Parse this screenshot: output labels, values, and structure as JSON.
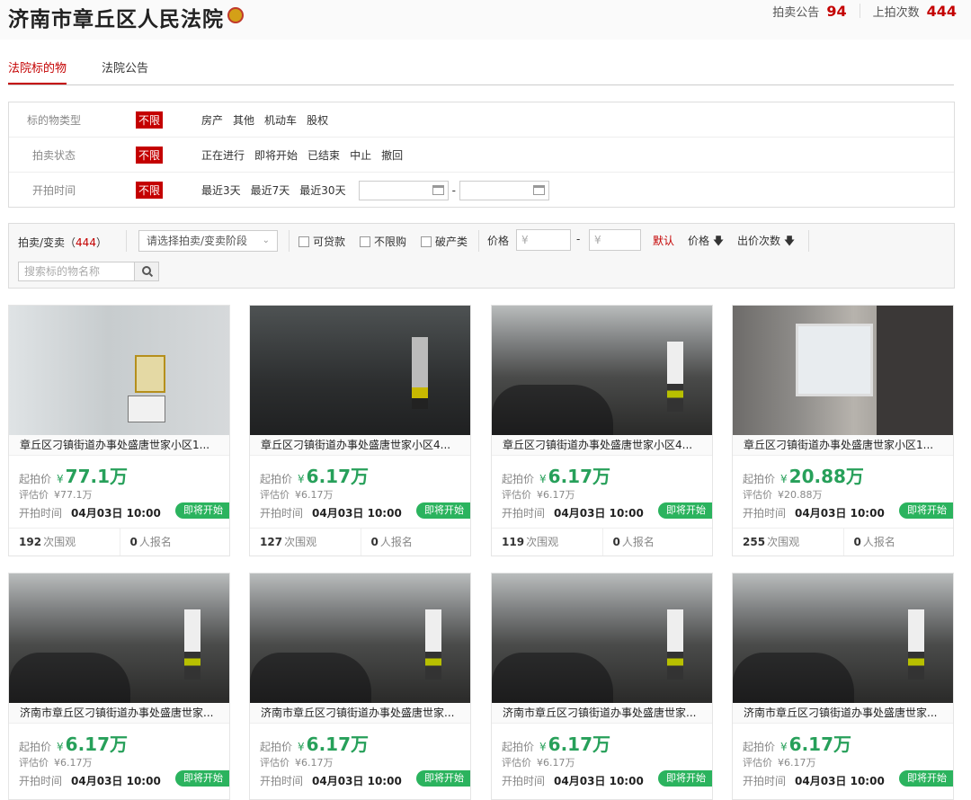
{
  "header": {
    "court_name": "济南市章丘区人民法院",
    "notice_label": "拍卖公告",
    "notice_count": "94",
    "auction_label": "上拍次数",
    "auction_count": "444"
  },
  "tabs": [
    "法院标的物",
    "法院公告"
  ],
  "filters": {
    "unlimited": "不限",
    "rows": [
      {
        "label": "标的物类型",
        "options": [
          "房产",
          "其他",
          "机动车",
          "股权"
        ]
      },
      {
        "label": "拍卖状态",
        "options": [
          "正在进行",
          "即将开始",
          "已结束",
          "中止",
          "撤回"
        ]
      },
      {
        "label": "开拍时间",
        "options": [
          "最近3天",
          "最近7天",
          "最近30天"
        ]
      }
    ],
    "date_separator": "-"
  },
  "toolbar": {
    "auction_type_label": "拍卖/变卖（",
    "auction_type_count": "444",
    "auction_type_close": "）",
    "stage_select": "请选择拍卖/变卖阶段",
    "checkboxes": [
      "可贷款",
      "不限购",
      "破产类"
    ],
    "price_label": "价格",
    "price_min_placeholder": "¥",
    "price_max_placeholder": "¥",
    "price_dash": "-",
    "sort_default": "默认",
    "sort_price": "价格",
    "sort_bids": "出价次数",
    "search_placeholder": "搜索标的物名称"
  },
  "card_labels": {
    "start_price": "起拍价",
    "eval_price": "评估价",
    "start_time": "开拍时间",
    "badge": "即将开始",
    "views_suffix": "次围观",
    "signups_suffix": "人报名",
    "currency": "¥"
  },
  "cards": [
    {
      "title": "章丘区刁镇街道办事处盛唐世家小区1...",
      "price": "77.1万",
      "eval": "¥77.1万",
      "time": "04月03日 10:00",
      "views": "192",
      "signups": "0",
      "image": "gas-meter-photo"
    },
    {
      "title": "章丘区刁镇街道办事处盛唐世家小区4...",
      "price": "6.17万",
      "eval": "¥6.17万",
      "time": "04月03日 10:00",
      "views": "127",
      "signups": "0",
      "image": "underground-garage-photo"
    },
    {
      "title": "章丘区刁镇街道办事处盛唐世家小区4...",
      "price": "6.17万",
      "eval": "¥6.17万",
      "time": "04月03日 10:00",
      "views": "119",
      "signups": "0",
      "image": "parking-car-photo"
    },
    {
      "title": "章丘区刁镇街道办事处盛唐世家小区1...",
      "price": "20.88万",
      "eval": "¥20.88万",
      "time": "04月03日 10:00",
      "views": "255",
      "signups": "0",
      "image": "interior-room-photo"
    },
    {
      "title": "济南市章丘区刁镇街道办事处盛唐世家...",
      "price": "6.17万",
      "eval": "¥6.17万",
      "time": "04月03日 10:00",
      "views": "",
      "signups": "",
      "image": "parking-car-photo"
    },
    {
      "title": "济南市章丘区刁镇街道办事处盛唐世家...",
      "price": "6.17万",
      "eval": "¥6.17万",
      "time": "04月03日 10:00",
      "views": "",
      "signups": "",
      "image": "parking-car-photo"
    },
    {
      "title": "济南市章丘区刁镇街道办事处盛唐世家...",
      "price": "6.17万",
      "eval": "¥6.17万",
      "time": "04月03日 10:00",
      "views": "",
      "signups": "",
      "image": "parking-car-photo"
    },
    {
      "title": "济南市章丘区刁镇街道办事处盛唐世家...",
      "price": "6.17万",
      "eval": "¥6.17万",
      "time": "04月03日 10:00",
      "views": "",
      "signups": "",
      "image": "parking-car-photo"
    }
  ],
  "colors": {
    "accent_red": "#c40000",
    "price_green": "#27a05a",
    "badge_green": "#2bb35e"
  }
}
